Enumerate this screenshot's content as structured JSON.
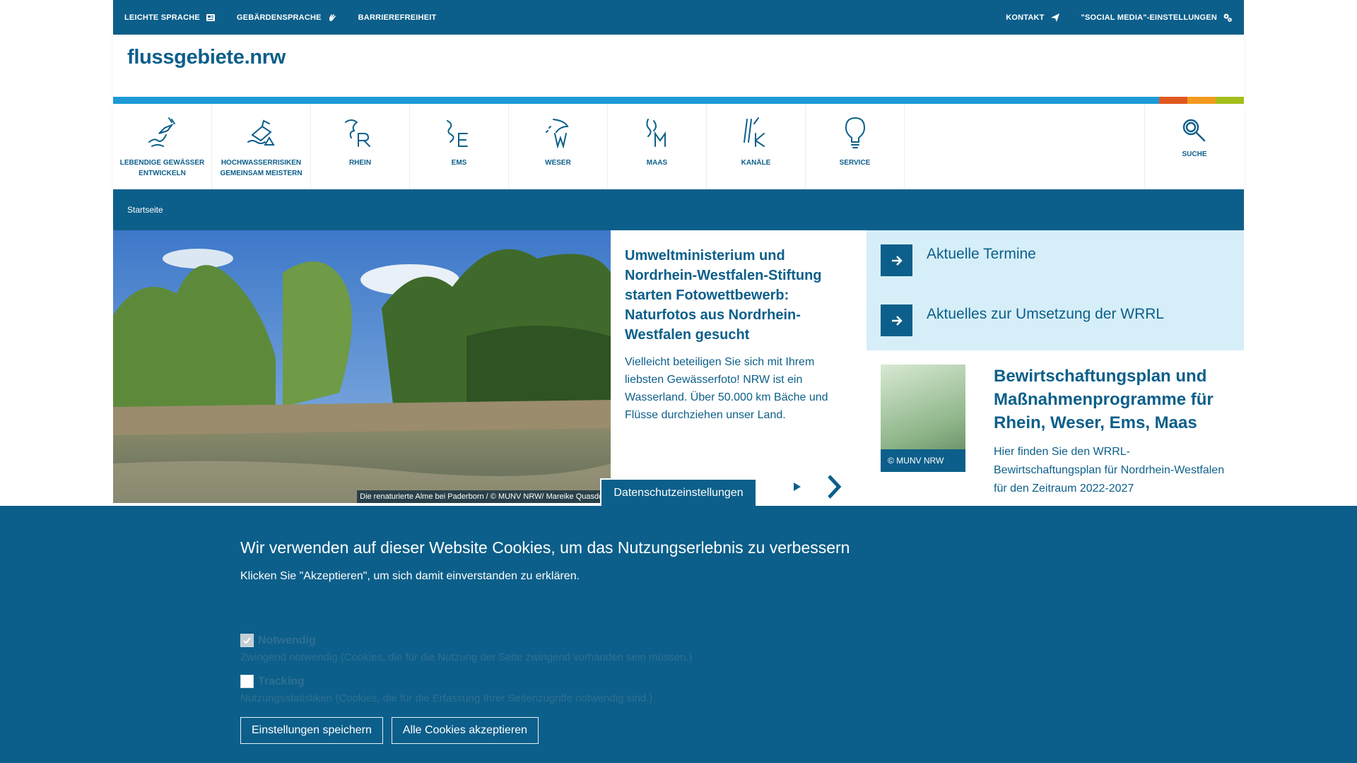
{
  "topbar": {
    "left": [
      "LEICHTE SPRACHE",
      "GEBÄRDENSPRACHE",
      "BARRIEREFREIHEIT"
    ],
    "right": [
      "KONTAKT",
      "\"SOCIAL MEDIA\"-EINSTELLUNGEN"
    ]
  },
  "header": {
    "logo": "flussgebiete.nrw"
  },
  "colors": {
    "primary": "#0c5f8a",
    "bar_blue": "#1d9ad6",
    "bar_red": "#e0571f",
    "bar_orange": "#f29a1d",
    "bar_green": "#a4bf1b"
  },
  "nav": {
    "items": [
      {
        "label": "LEBENDIGE GEWÄSSER ENTWICKELN",
        "icon": "river-bird-icon"
      },
      {
        "label": "HOCHWASSERRISIKEN GEMEINSAM MEISTERN",
        "icon": "flood-house-icon"
      },
      {
        "label": "RHEIN",
        "icon": "rhein-icon",
        "letter": "R"
      },
      {
        "label": "EMS",
        "icon": "ems-icon",
        "letter": "E"
      },
      {
        "label": "WESER",
        "icon": "weser-icon",
        "letter": "W"
      },
      {
        "label": "MAAS",
        "icon": "maas-icon",
        "letter": "M"
      },
      {
        "label": "KANÄLE",
        "icon": "kanaele-icon",
        "letter": "K"
      },
      {
        "label": "SERVICE",
        "icon": "lightbulb-icon"
      }
    ],
    "search_label": "SUCHE"
  },
  "breadcrumb": {
    "home": "Startseite"
  },
  "hero": {
    "caption": "Die renaturierte Alme bei Paderborn  / © MUNV NRW/ Mareike Quasdorf",
    "title": "Umweltministerium und Nordrhein-Westfalen-Stiftung starten Fotowettbewerb: Naturfotos aus Nordrhein-Westfalen gesucht",
    "text": "Vielleicht beteiligen Sie sich mit Ihrem liebsten Gewässerfoto! NRW ist ein Wasserland. Über 50.000 km Bäche und Flüsse durchziehen unser Land."
  },
  "quicklinks": [
    "Aktuelle Termine",
    "Aktuelles zur Umsetzung der WRRL"
  ],
  "plan": {
    "badge": "© MUNV NRW",
    "title": "Bewirtschaftungsplan und Maßnahmenprogramme für Rhein, Weser, Ems, Maas",
    "text": "Hier finden Sie den WRRL-Bewirtschaftungsplan für Nordrhein-Westfalen für den Zeitraum 2022-2027"
  },
  "privacy_tab": "Datenschutzeinstellungen",
  "cookie": {
    "title": "Wir verwenden auf dieser Website Cookies, um das Nutzungserlebnis zu verbessern",
    "subtitle": "Klicken Sie \"Akzeptieren\", um sich damit einverstanden zu erklären.",
    "options": [
      {
        "name": "Notwendig",
        "desc": "Zwingend notwendig (Cookies, die für die Nutzung der Seite zwingend vorhanden sein müssen.)",
        "checked": true
      },
      {
        "name": "Tracking",
        "desc": "Nutzungsstatistiken (Cookies, die für die Erfassung Ihrer Seitenzugriffe notwendig sind.)",
        "checked": false
      }
    ],
    "save_label": "Einstellungen speichern",
    "accept_label": "Alle Cookies akzeptieren"
  }
}
